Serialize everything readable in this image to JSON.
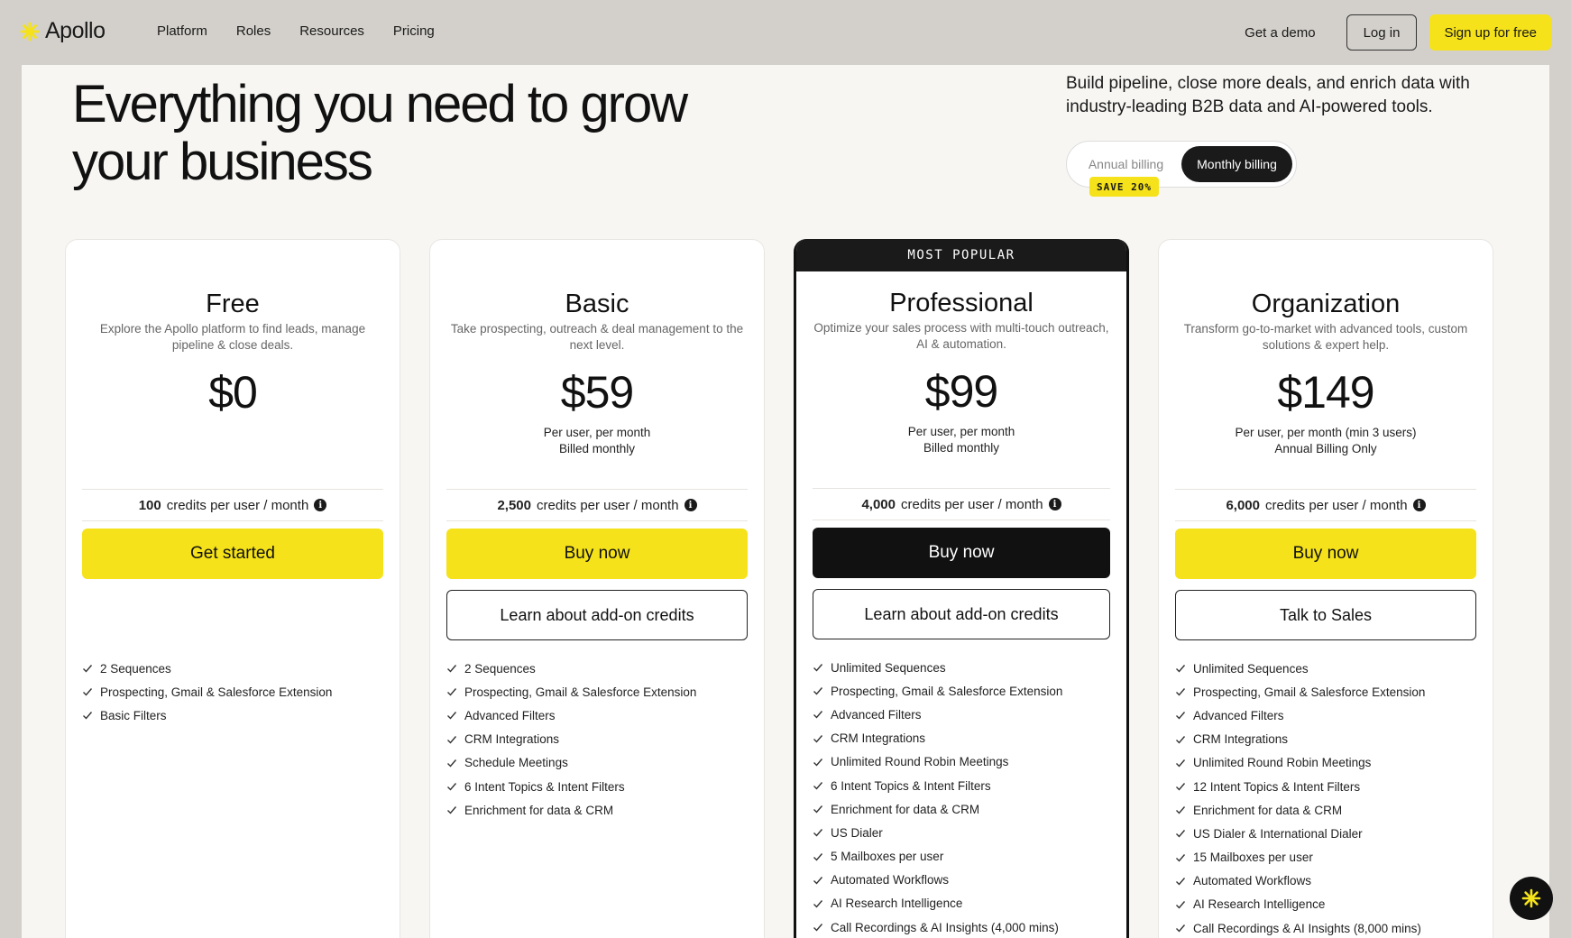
{
  "nav": {
    "brand": "Apollo",
    "links": [
      "Platform",
      "Roles",
      "Resources",
      "Pricing"
    ],
    "demo": "Get a demo",
    "login": "Log in",
    "signup": "Sign up for free"
  },
  "hero": {
    "title": "Everything you need to grow your business",
    "subtitle": "Build pipeline, close more deals, and enrich data with industry-leading B2B data and AI-powered tools."
  },
  "billing": {
    "annual": "Annual billing",
    "monthly": "Monthly billing",
    "selected": "Monthly billing",
    "save_badge": "SAVE 20%"
  },
  "accent_color": "#f5e21a",
  "plans": [
    {
      "name": "Free",
      "description": "Explore the Apollo platform to find leads, manage pipeline & close deals.",
      "price": "$0",
      "note_line1": "",
      "note_line2": "",
      "credits_amount": "100",
      "credits_suffix": "credits per user / month",
      "cta": "Get started",
      "secondary": "",
      "features": [
        "2 Sequences",
        "Prospecting, Gmail & Salesforce Extension",
        "Basic Filters"
      ]
    },
    {
      "name": "Basic",
      "description": "Take prospecting, outreach & deal management to the next level.",
      "price": "$59",
      "note_line1": "Per user, per month",
      "note_line2": "Billed monthly",
      "credits_amount": "2,500",
      "credits_suffix": "credits per user / month",
      "cta": "Buy now",
      "secondary": "Learn about add-on credits",
      "features": [
        "2 Sequences",
        "Prospecting, Gmail & Salesforce Extension",
        "Advanced Filters",
        "CRM Integrations",
        "Schedule Meetings",
        "6 Intent Topics & Intent Filters",
        "Enrichment for data & CRM"
      ]
    },
    {
      "name": "Professional",
      "badge": "MOST POPULAR",
      "description": "Optimize your sales process with multi-touch outreach, AI & automation.",
      "price": "$99",
      "note_line1": "Per user, per month",
      "note_line2": "Billed monthly",
      "credits_amount": "4,000",
      "credits_suffix": "credits per user / month",
      "cta": "Buy now",
      "secondary": "Learn about add-on credits",
      "features": [
        "Unlimited Sequences",
        "Prospecting, Gmail & Salesforce Extension",
        "Advanced Filters",
        "CRM Integrations",
        "Unlimited Round Robin Meetings",
        "6 Intent Topics & Intent Filters",
        "Enrichment for data & CRM",
        "US Dialer",
        "5 Mailboxes per user",
        "Automated Workflows",
        "AI Research Intelligence",
        "Call Recordings & AI Insights (4,000 mins)"
      ]
    },
    {
      "name": "Organization",
      "description": "Transform go-to-market with advanced tools, custom solutions & expert help.",
      "price": "$149",
      "note_line1": "Per user, per month (min 3 users)",
      "note_line2": "Annual Billing Only",
      "credits_amount": "6,000",
      "credits_suffix": "credits per user / month",
      "cta": "Buy now",
      "secondary": "Talk to Sales",
      "features": [
        "Unlimited Sequences",
        "Prospecting, Gmail & Salesforce Extension",
        "Advanced Filters",
        "CRM Integrations",
        "Unlimited Round Robin Meetings",
        "12 Intent Topics & Intent Filters",
        "Enrichment for data & CRM",
        "US Dialer & International Dialer",
        "15 Mailboxes per user",
        "Automated Workflows",
        "AI Research Intelligence",
        "Call Recordings & AI Insights (8,000 mins)"
      ]
    }
  ]
}
